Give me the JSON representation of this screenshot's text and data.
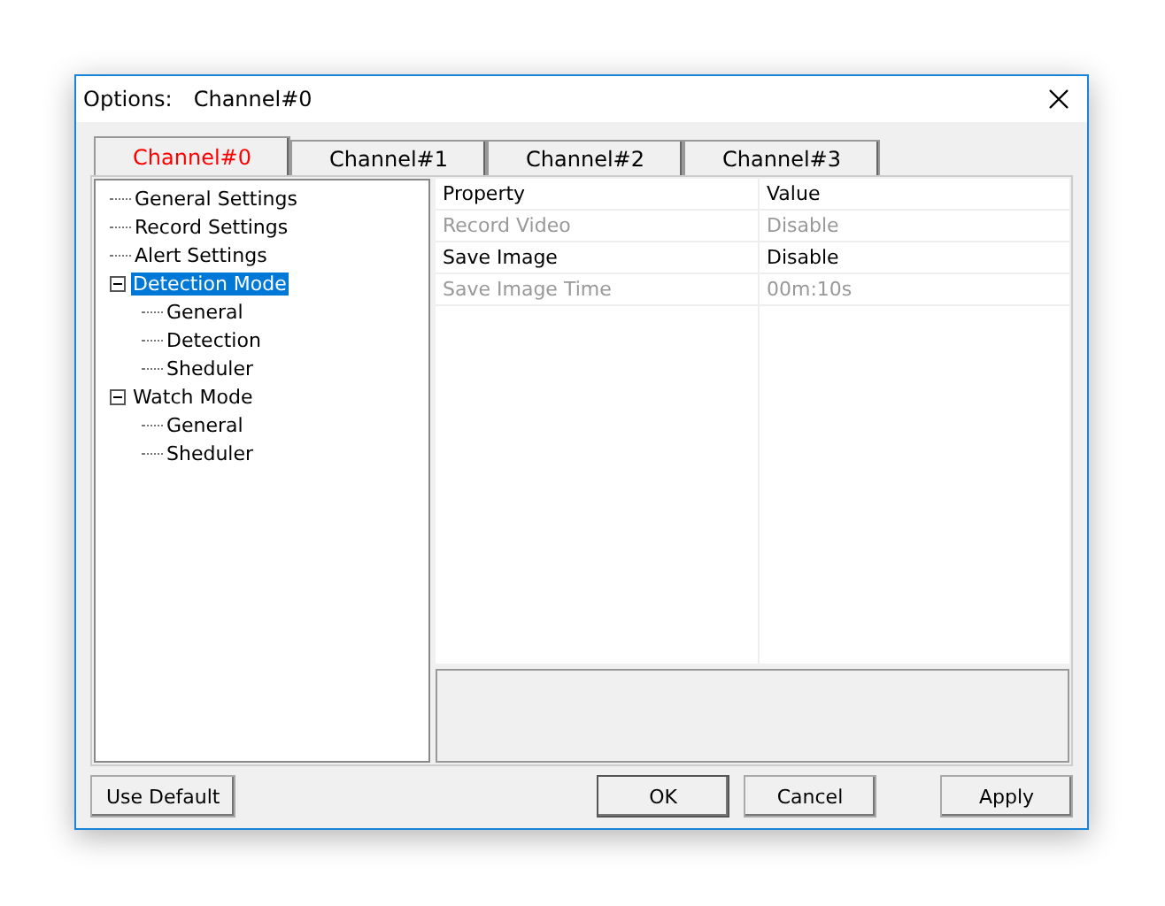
{
  "window": {
    "title_label": "Options:",
    "title": "Channel#0"
  },
  "tabs": [
    {
      "label": "Channel#0",
      "selected": true
    },
    {
      "label": "Channel#1",
      "selected": false
    },
    {
      "label": "Channel#2",
      "selected": false
    },
    {
      "label": "Channel#3",
      "selected": false
    }
  ],
  "tree": [
    {
      "label": "General Settings",
      "selected": false
    },
    {
      "label": "Record Settings",
      "selected": false
    },
    {
      "label": "Alert Settings",
      "selected": false
    },
    {
      "label": "Detection Mode",
      "selected": true,
      "expanded": true,
      "children": [
        {
          "label": "General",
          "selected": false
        },
        {
          "label": "Detection",
          "selected": false
        },
        {
          "label": "Sheduler",
          "selected": false
        }
      ]
    },
    {
      "label": "Watch Mode",
      "selected": false,
      "expanded": true,
      "children": [
        {
          "label": "General",
          "selected": false
        },
        {
          "label": "Sheduler",
          "selected": false
        }
      ]
    }
  ],
  "property_grid": {
    "columns": [
      "Property",
      "Value"
    ],
    "rows": [
      {
        "property": "Record Video",
        "value": "Disable",
        "disabled": true
      },
      {
        "property": "Save Image",
        "value": "Disable",
        "disabled": false
      },
      {
        "property": "Save Image Time",
        "value": "00m:10s",
        "disabled": true
      }
    ]
  },
  "buttons": {
    "left": "Use Default",
    "right": [
      "OK",
      "Cancel",
      "Apply"
    ]
  }
}
